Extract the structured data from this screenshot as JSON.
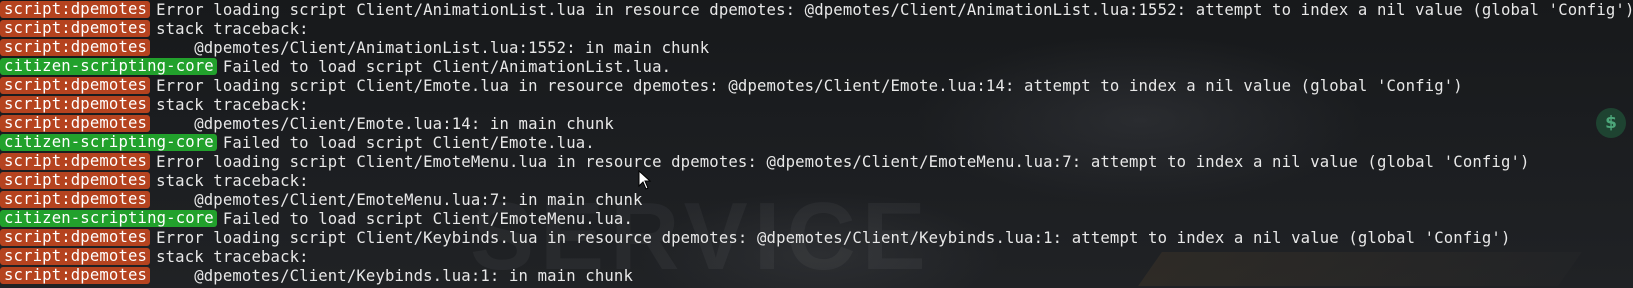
{
  "background": {
    "watermark_text": "SERVICE",
    "money_icon": "$"
  },
  "console": {
    "lines": [
      {
        "tag": "script:dpemotes",
        "tag_color": "#b5431f",
        "text": "Error loading script Client/AnimationList.lua in resource dpemotes: @dpemotes/Client/AnimationList.lua:1552: attempt to index a nil value (global 'Config')"
      },
      {
        "tag": "script:dpemotes",
        "tag_color": "#b5431f",
        "text": "stack traceback:"
      },
      {
        "tag": "script:dpemotes",
        "tag_color": "#b5431f",
        "text": "    @dpemotes/Client/AnimationList.lua:1552: in main chunk"
      },
      {
        "tag": "citizen-scripting-core",
        "tag_color": "#22a12c",
        "text": "Failed to load script Client/AnimationList.lua."
      },
      {
        "tag": "script:dpemotes",
        "tag_color": "#b5431f",
        "text": "Error loading script Client/Emote.lua in resource dpemotes: @dpemotes/Client/Emote.lua:14: attempt to index a nil value (global 'Config')"
      },
      {
        "tag": "script:dpemotes",
        "tag_color": "#b5431f",
        "text": "stack traceback:"
      },
      {
        "tag": "script:dpemotes",
        "tag_color": "#b5431f",
        "text": "    @dpemotes/Client/Emote.lua:14: in main chunk"
      },
      {
        "tag": "citizen-scripting-core",
        "tag_color": "#22a12c",
        "text": "Failed to load script Client/Emote.lua."
      },
      {
        "tag": "script:dpemotes",
        "tag_color": "#b5431f",
        "text": "Error loading script Client/EmoteMenu.lua in resource dpemotes: @dpemotes/Client/EmoteMenu.lua:7: attempt to index a nil value (global 'Config')"
      },
      {
        "tag": "script:dpemotes",
        "tag_color": "#b5431f",
        "text": "stack traceback:"
      },
      {
        "tag": "script:dpemotes",
        "tag_color": "#b5431f",
        "text": "    @dpemotes/Client/EmoteMenu.lua:7: in main chunk"
      },
      {
        "tag": "citizen-scripting-core",
        "tag_color": "#22a12c",
        "text": "Failed to load script Client/EmoteMenu.lua."
      },
      {
        "tag": "script:dpemotes",
        "tag_color": "#b5431f",
        "text": "Error loading script Client/Keybinds.lua in resource dpemotes: @dpemotes/Client/Keybinds.lua:1: attempt to index a nil value (global 'Config')"
      },
      {
        "tag": "script:dpemotes",
        "tag_color": "#b5431f",
        "text": "stack traceback:"
      },
      {
        "tag": "script:dpemotes",
        "tag_color": "#b5431f",
        "text": "    @dpemotes/Client/Keybinds.lua:1: in main chunk"
      }
    ]
  }
}
